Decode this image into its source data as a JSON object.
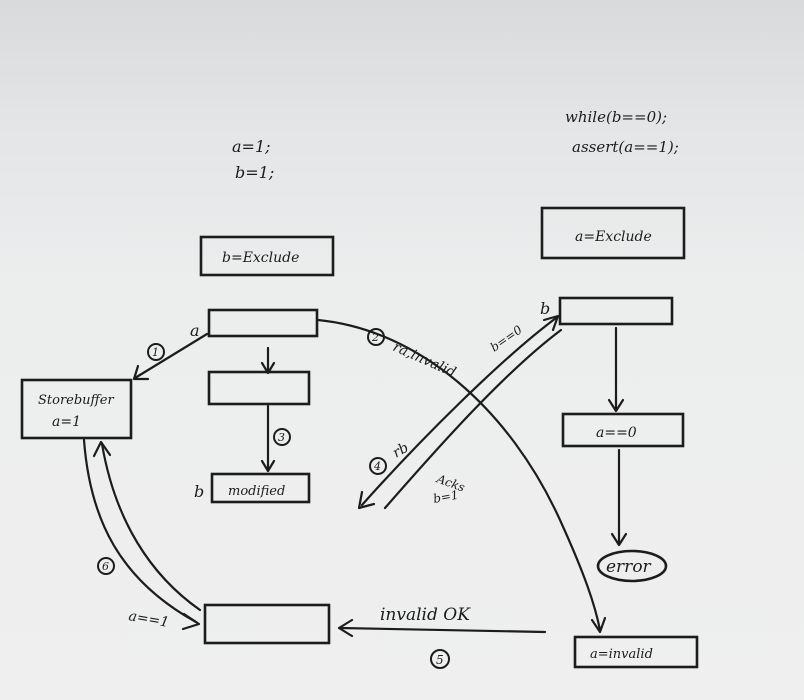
{
  "code_left": [
    "a=1;",
    "b=1;"
  ],
  "code_right": [
    "while(b==0);",
    "assert(a==1);"
  ],
  "boxes": {
    "left_top": "b=Exclude",
    "left_modified": "modified",
    "storebuffer_title": "Storebuffer",
    "storebuffer_value": "a=1",
    "right_top": "a=Exclude",
    "right_middle": "a==0",
    "right_invalid": "a=invalid",
    "error": "error"
  },
  "row_labels": {
    "left_a": "a",
    "left_b": "b",
    "right_b": "b"
  },
  "arrows": {
    "step1": "1",
    "step2": "2",
    "step2_text": "ra,invalid",
    "step3": "3",
    "step4": "4",
    "step4_text": "rb",
    "acks_text": "Acks",
    "acks_value": "b=1",
    "b_check": "b==0",
    "step5": "5",
    "step5_text": "invalid OK",
    "step6": "6",
    "step6_text": "a==1"
  }
}
